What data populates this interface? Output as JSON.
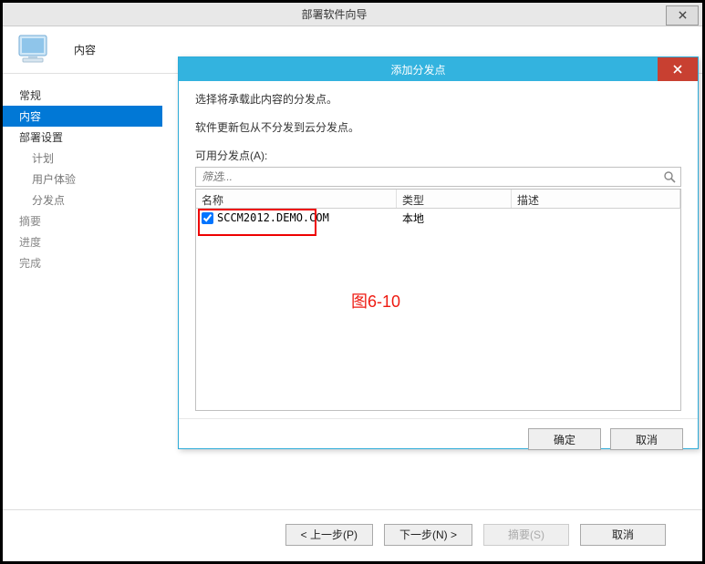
{
  "wizard": {
    "title": "部署软件向导",
    "section": "内容",
    "sidebar": [
      {
        "label": "常规",
        "active": false,
        "sub": false
      },
      {
        "label": "内容",
        "active": true,
        "sub": false
      },
      {
        "label": "部署设置",
        "active": false,
        "sub": false
      },
      {
        "label": "计划",
        "active": false,
        "sub": true
      },
      {
        "label": "用户体验",
        "active": false,
        "sub": true
      },
      {
        "label": "分发点",
        "active": false,
        "sub": true
      },
      {
        "label": "摘要",
        "active": false,
        "sub": false,
        "disabled": true
      },
      {
        "label": "进度",
        "active": false,
        "sub": false,
        "disabled": true
      },
      {
        "label": "完成",
        "active": false,
        "sub": false,
        "disabled": true
      }
    ],
    "buttons": {
      "prev": "< 上一步(P)",
      "next": "下一步(N) >",
      "summary": "摘要(S)",
      "cancel": "取消"
    }
  },
  "modal": {
    "title": "添加分发点",
    "line1": "选择将承载此内容的分发点。",
    "line2": "软件更新包从不分发到云分发点。",
    "list_label": "可用分发点(A):",
    "filter_placeholder": "筛选...",
    "columns": {
      "name": "名称",
      "type": "类型",
      "desc": "描述"
    },
    "rows": [
      {
        "checked": true,
        "name": "SCCM2012.DEMO.COM",
        "type": "本地",
        "desc": ""
      }
    ],
    "buttons": {
      "ok": "确定",
      "cancel": "取消"
    },
    "annotation": "图6-10"
  }
}
